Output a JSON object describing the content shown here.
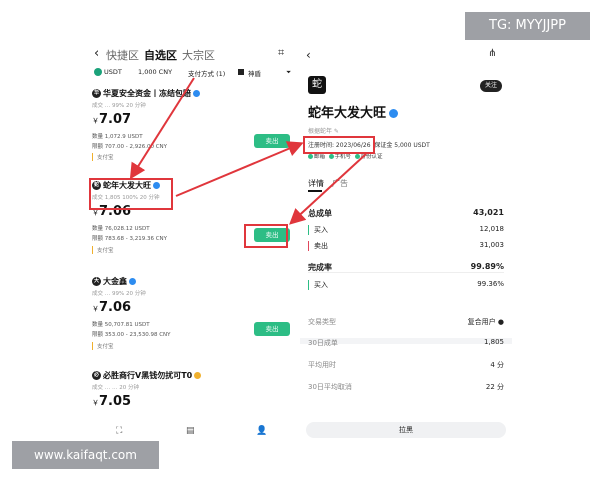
{
  "left": {
    "nav": {
      "back": "‹",
      "tab1": "快捷区",
      "tab2": "自选区",
      "tab3": "大宗区",
      "scan": "⌗"
    },
    "filter": {
      "coin": "USDT",
      "amount": "1,000 CNY",
      "pay": "支付方式 (1)",
      "verified": "神盾",
      "funnel": "⏷"
    },
    "merchants": [
      {
        "name": "华夏安全资金丨冻结包赔",
        "stats": "成交 …   99%   20 分钟",
        "price": "7.07",
        "qty": "数量  1,072.9 USDT",
        "limit": "限额  707.00 - 2,926.00 CNY",
        "pay": "支付宝",
        "btn": "卖出",
        "icon": "华"
      },
      {
        "name": "蛇年大发大旺",
        "stats": "成交 1,805   100%   20 分钟",
        "price": "7.06",
        "qty": "数量  76,028.12 USDT",
        "limit": "限额  783.68 - 3,219.36 CNY",
        "pay": "支付宝",
        "btn": "卖出",
        "icon": "蛇"
      },
      {
        "name": "大金鑫",
        "stats": "成交 …   99%   20 分钟",
        "price": "7.06",
        "qty": "数量  50,707.81 USDT",
        "limit": "限额  353.00 - 23,530.98 CNY",
        "pay": "支付宝",
        "btn": "卖出",
        "icon": "大"
      },
      {
        "name": "必胜商行V黑钱勿扰可T0",
        "stats": "成交 …   …   20 分钟",
        "price": "7.05",
        "icon": "必"
      }
    ],
    "currency_sign": "￥",
    "bottom": {
      "a": "⛶",
      "b": "▤",
      "c": "👤"
    }
  },
  "right": {
    "back": "‹",
    "share": "⋔",
    "avatar": "蛇",
    "follow": "关注",
    "name": "蛇年大发大旺",
    "sub": "根据蛇年 ✎",
    "reg": "注册时间: 2023/06/26",
    "deposit": "保证金 5,000 USDT",
    "badges": [
      "邮箱",
      "手机号",
      "身份认证"
    ],
    "tabs": {
      "t1": "详情",
      "t2": "广告"
    },
    "rows": [
      {
        "k": "总成单",
        "v": "43,021",
        "cls": "head"
      },
      {
        "k": "买入",
        "v": "12,018",
        "cls": "sm"
      },
      {
        "k": "卖出",
        "v": "31,003",
        "cls": "sm red"
      },
      {
        "k": "完成率",
        "v": "99.89%",
        "cls": "head"
      },
      {
        "k": "买入",
        "v": "99.36%",
        "cls": "sm"
      },
      {
        "k": "交易类型",
        "v": "复合用户 ●",
        "cls": "gray"
      },
      {
        "k": "30日成单",
        "v": "1,805",
        "cls": "gray"
      },
      {
        "k": "平均用时",
        "v": "4 分",
        "cls": "gray"
      },
      {
        "k": "30日平均取消",
        "v": "22 分",
        "cls": "gray"
      }
    ],
    "block_btn": "拉黑"
  },
  "overlay": {
    "tg": "TG: MYYJJPP",
    "site": "www.kaifaqt.com"
  },
  "colors": {
    "accent_green": "#2dbd85",
    "highlight_red": "#e0363c",
    "verify_blue": "#2d8cf0"
  }
}
